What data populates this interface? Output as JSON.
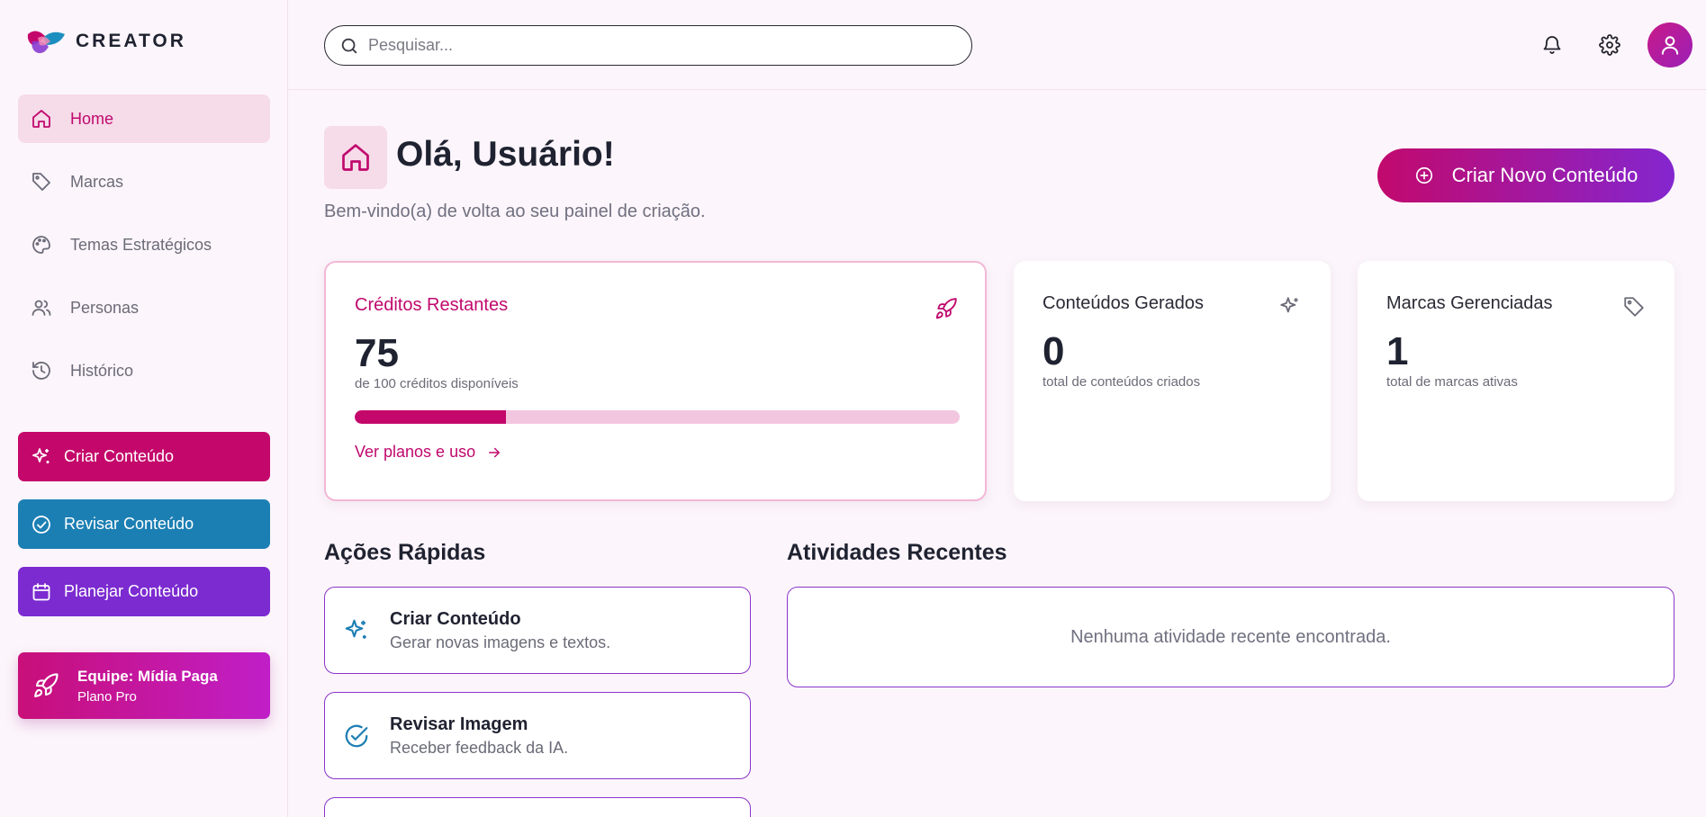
{
  "brand": {
    "name": "CREATOR"
  },
  "sidebar": {
    "nav": [
      {
        "label": "Home",
        "icon": "home-icon",
        "active": true
      },
      {
        "label": "Marcas",
        "icon": "tag-icon"
      },
      {
        "label": "Temas Estratégicos",
        "icon": "palette-icon"
      },
      {
        "label": "Personas",
        "icon": "users-icon"
      },
      {
        "label": "Histórico",
        "icon": "history-icon"
      }
    ],
    "actions": {
      "create": {
        "label": "Criar Conteúdo",
        "color": "#c4076b"
      },
      "review": {
        "label": "Revisar Conteúdo",
        "color": "#1c7fb3"
      },
      "plan": {
        "label": "Planejar Conteúdo",
        "color": "#7b2bd0"
      }
    },
    "team": {
      "name": "Equipe: Mídia Paga",
      "plan": "Plano Pro"
    }
  },
  "search": {
    "placeholder": "Pesquisar...",
    "value": ""
  },
  "header": {
    "greeting": "Olá, Usuário!",
    "subtitle": "Bem-vindo(a) de volta ao seu painel de criação.",
    "cta_label": "Criar Novo Conteúdo"
  },
  "stats": {
    "credits": {
      "title": "Créditos Restantes",
      "value": "75",
      "caption": "de 100 créditos disponíveis",
      "progress_fraction": 0.25,
      "link": "Ver planos e uso"
    },
    "content": {
      "title": "Conteúdos Gerados",
      "value": "0",
      "caption": "total de conteúdos criados"
    },
    "brands": {
      "title": "Marcas Gerenciadas",
      "value": "1",
      "caption": "total de marcas ativas"
    }
  },
  "quick_actions": {
    "title": "Ações Rápidas",
    "items": [
      {
        "title": "Criar Conteúdo",
        "desc": "Gerar novas imagens e textos.",
        "icon": "sparkles-icon"
      },
      {
        "title": "Revisar Imagem",
        "desc": "Receber feedback da IA.",
        "icon": "check-circle-icon"
      }
    ]
  },
  "recent": {
    "title": "Atividades Recentes",
    "empty": "Nenhuma atividade recente encontrada."
  },
  "colors": {
    "accent": "#c4076b",
    "purple": "#7b2bd0",
    "blue": "#1c7fb3",
    "background": "#fcf5fb"
  }
}
